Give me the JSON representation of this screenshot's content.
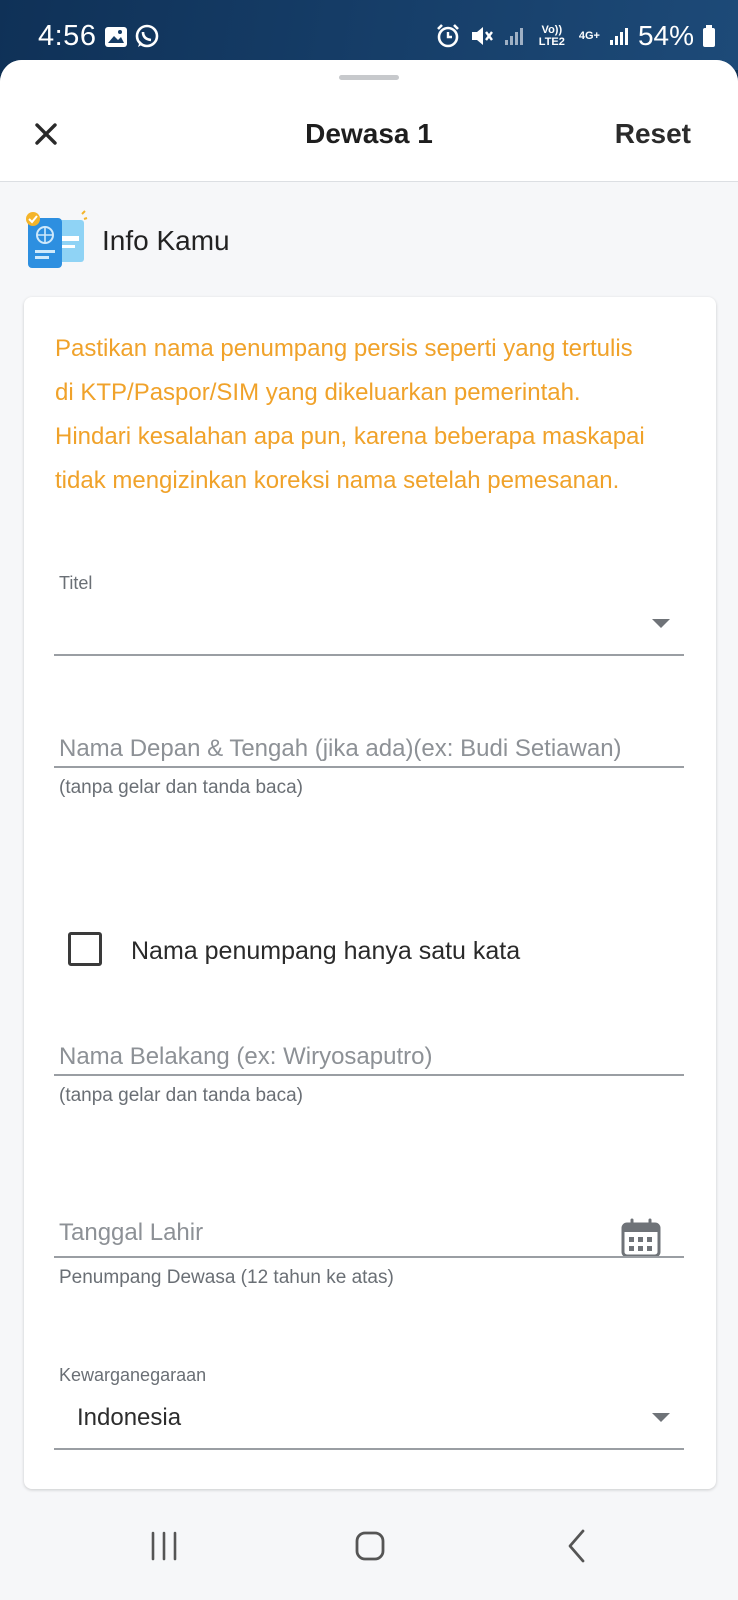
{
  "status_bar": {
    "time": "4:56",
    "battery_percent": "54%",
    "network_label_1": "Vo)) LTE2",
    "network_label_2": "4G+",
    "icons": [
      "gallery-icon",
      "whatsapp-icon",
      "alarm-icon",
      "mute-icon",
      "signal-icon",
      "battery-icon"
    ]
  },
  "header": {
    "title": "Dewasa 1",
    "reset_label": "Reset",
    "close_icon": "close-icon"
  },
  "section": {
    "title": "Info Kamu",
    "icon": "passport-visa-icon"
  },
  "form": {
    "notice": "Pastikan nama penumpang persis seperti yang tertulis di KTP/Paspor/SIM yang dikeluarkan pemerintah. Hindari kesalahan apa pun, karena beberapa maskapai tidak mengizinkan koreksi nama setelah pemesanan.",
    "title_field": {
      "label": "Titel",
      "value": ""
    },
    "first_name": {
      "placeholder": "Nama Depan & Tengah (jika ada)(ex: Budi Setiawan)",
      "helper": "(tanpa gelar dan tanda baca)"
    },
    "single_name_checkbox": {
      "label": "Nama penumpang hanya satu kata",
      "checked": false
    },
    "last_name": {
      "placeholder": "Nama Belakang (ex: Wiryosaputro)",
      "helper": "(tanpa gelar dan tanda baca)"
    },
    "birth_date": {
      "placeholder": "Tanggal Lahir",
      "helper": "Penumpang Dewasa (12 tahun ke atas)"
    },
    "nationality": {
      "label": "Kewarganegaraan",
      "value": "Indonesia"
    }
  },
  "colors": {
    "notice": "#f0a22a",
    "status_bar": "#0f3157",
    "sheet_bg": "#f6f7f9"
  }
}
